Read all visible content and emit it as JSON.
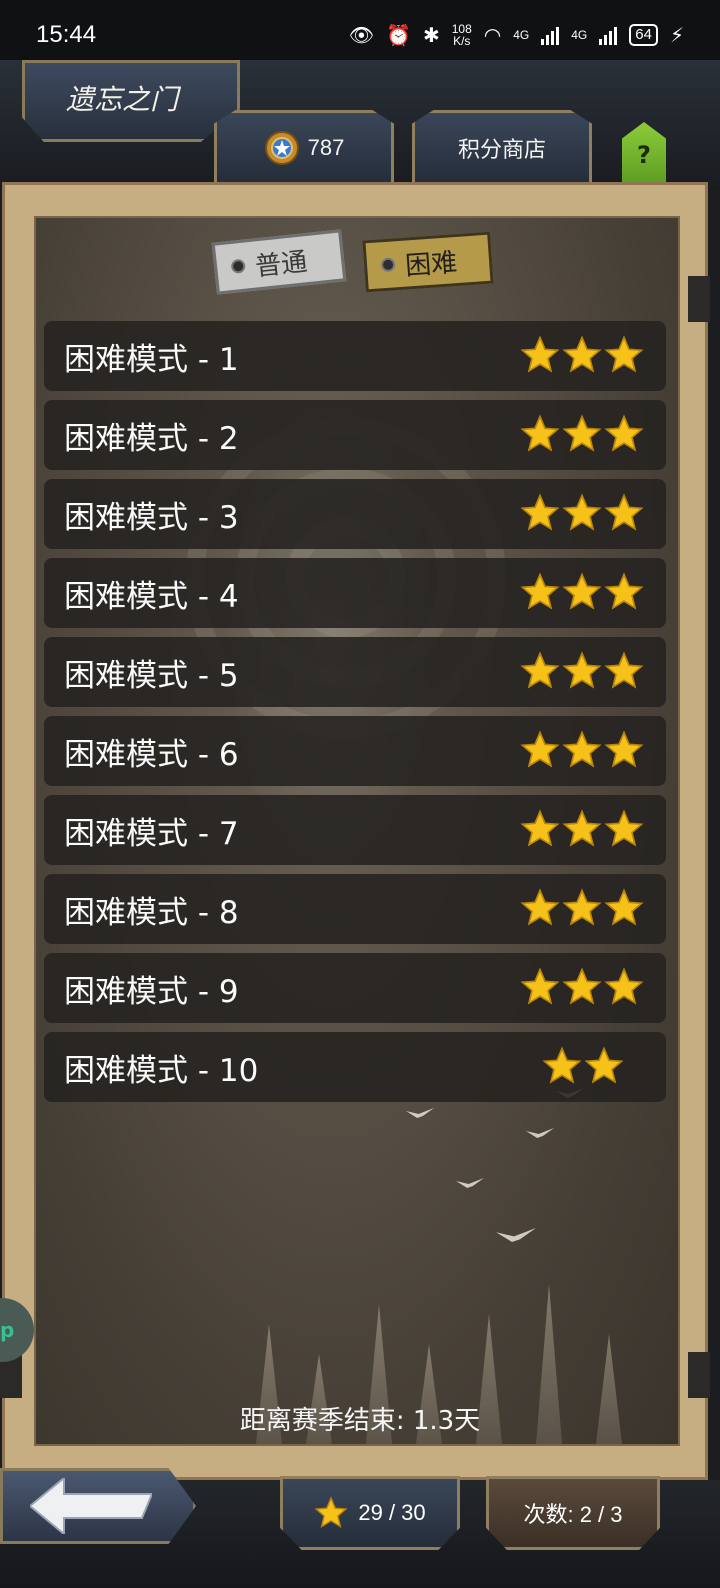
{
  "status_bar": {
    "time": "15:44",
    "net_speed_value": "108",
    "net_speed_unit": "K/s",
    "network_1": "4G",
    "network_2": "4G",
    "battery": "64"
  },
  "header": {
    "title": "遗忘之门",
    "points": "787",
    "shop_label": "积分商店",
    "help_label": "?"
  },
  "mode_tabs": {
    "normal_label": "普通",
    "hard_label": "困难",
    "selected": "hard"
  },
  "levels": [
    {
      "name": "困难模式 - 1",
      "stars": 3
    },
    {
      "name": "困难模式 - 2",
      "stars": 3
    },
    {
      "name": "困难模式 - 3",
      "stars": 3
    },
    {
      "name": "困难模式 - 4",
      "stars": 3
    },
    {
      "name": "困难模式 - 5",
      "stars": 3
    },
    {
      "name": "困难模式 - 6",
      "stars": 3
    },
    {
      "name": "困难模式 - 7",
      "stars": 3
    },
    {
      "name": "困难模式 - 8",
      "stars": 3
    },
    {
      "name": "困难模式 - 9",
      "stars": 3
    },
    {
      "name": "困难模式 - 10",
      "stars": 2
    }
  ],
  "season_end_text": "距离赛季结束: 1.3天",
  "side_pill_label": "p",
  "footer": {
    "stars_total": "29 / 30",
    "attempts": "次数: 2 / 3"
  },
  "colors": {
    "star": "#f6c21a",
    "frame": "#c6ad82",
    "row_bg": "#242220",
    "help_green": "#8ccc3a"
  }
}
